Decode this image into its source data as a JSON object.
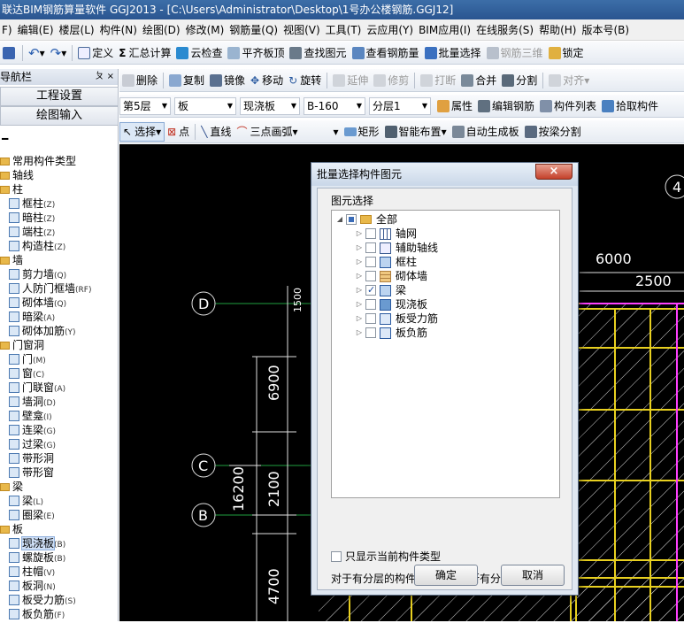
{
  "window": {
    "title": "联达BIM钢筋算量软件 GGJ2013 - [C:\\Users\\Administrator\\Desktop\\1号办公楼钢筋.GGJ12]"
  },
  "menu": [
    "F)",
    "编辑(E)",
    "楼层(L)",
    "构件(N)",
    "绘图(D)",
    "修改(M)",
    "钢筋量(Q)",
    "视图(V)",
    "工具(T)",
    "云应用(Y)",
    "BIM应用(I)",
    "在线服务(S)",
    "帮助(H)",
    "版本号(B)"
  ],
  "toolbar1": {
    "define": "定义",
    "sum": "汇总计算",
    "cloud_check": "云检查",
    "level_top": "平齐板顶",
    "find": "查找图元",
    "view_qty": "查看钢筋量",
    "batch_select": "批量选择",
    "rebar3d": "钢筋三维",
    "lock": "锁定"
  },
  "toolbar2": {
    "delete": "删除",
    "copy": "复制",
    "mirror": "镜像",
    "move": "移动",
    "rotate": "旋转",
    "extend": "延伸",
    "trim": "修剪",
    "break": "打断",
    "merge": "合并",
    "split": "分割",
    "align": "对齐"
  },
  "toolbar3": {
    "floor": "第5层",
    "category": "板",
    "type": "现浇板",
    "member": "B-160",
    "layer": "分层1",
    "props": "属性",
    "edit_rebar": "编辑钢筋",
    "member_list": "构件列表",
    "pick": "拾取构件"
  },
  "toolbar4": {
    "select": "选择",
    "point": "点",
    "line": "直线",
    "arc": "三点画弧",
    "rect": "矩形",
    "smart": "智能布置",
    "auto_slab": "自动生成板",
    "split_by_beam": "按梁分割"
  },
  "sidebar": {
    "title": "导航栏",
    "pin": "ㄆ ×",
    "btn1": "工程设置",
    "btn2": "绘图输入",
    "items": [
      {
        "text": "常用构件类型",
        "level": 0,
        "folder": true
      },
      {
        "text": "轴线",
        "level": 0,
        "folder": true
      },
      {
        "text": "柱",
        "level": 0,
        "folder": true
      },
      {
        "text": "框柱",
        "shortcut": "(Z)",
        "level": 1
      },
      {
        "text": "暗柱",
        "shortcut": "(Z)",
        "level": 1
      },
      {
        "text": "端柱",
        "shortcut": "(Z)",
        "level": 1
      },
      {
        "text": "构造柱",
        "shortcut": "(Z)",
        "level": 1
      },
      {
        "text": "墙",
        "level": 0,
        "folder": true
      },
      {
        "text": "剪力墙",
        "shortcut": "(Q)",
        "level": 1
      },
      {
        "text": "人防门框墙",
        "shortcut": "(RF)",
        "level": 1
      },
      {
        "text": "砌体墙",
        "shortcut": "(Q)",
        "level": 1
      },
      {
        "text": "暗梁",
        "shortcut": "(A)",
        "level": 1
      },
      {
        "text": "砌体加筋",
        "shortcut": "(Y)",
        "level": 1
      },
      {
        "text": "门窗洞",
        "level": 0,
        "folder": true
      },
      {
        "text": "门",
        "shortcut": "(M)",
        "level": 1
      },
      {
        "text": "窗",
        "shortcut": "(C)",
        "level": 1
      },
      {
        "text": "门联窗",
        "shortcut": "(A)",
        "level": 1
      },
      {
        "text": "墙洞",
        "shortcut": "(D)",
        "level": 1
      },
      {
        "text": "壁龛",
        "shortcut": "(I)",
        "level": 1
      },
      {
        "text": "连梁",
        "shortcut": "(G)",
        "level": 1
      },
      {
        "text": "过梁",
        "shortcut": "(G)",
        "level": 1
      },
      {
        "text": "带形洞",
        "level": 1
      },
      {
        "text": "带形窗",
        "level": 1
      },
      {
        "text": "梁",
        "level": 0,
        "folder": true
      },
      {
        "text": "梁",
        "shortcut": "(L)",
        "level": 1
      },
      {
        "text": "圈梁",
        "shortcut": "(E)",
        "level": 1
      },
      {
        "text": "板",
        "level": 0,
        "folder": true
      },
      {
        "text": "现浇板",
        "shortcut": "(B)",
        "level": 1,
        "selected": true
      },
      {
        "text": "螺旋板",
        "shortcut": "(B)",
        "level": 1
      },
      {
        "text": "柱帽",
        "shortcut": "(V)",
        "level": 1
      },
      {
        "text": "板洞",
        "shortcut": "(N)",
        "level": 1
      },
      {
        "text": "板受力筋",
        "shortcut": "(S)",
        "level": 1
      },
      {
        "text": "板负筋",
        "shortcut": "(F)",
        "level": 1
      }
    ]
  },
  "canvas": {
    "axes": [
      "D",
      "C",
      "B"
    ],
    "dims": [
      "6900",
      "2100",
      "4700",
      "16200",
      "6000",
      "2500",
      "1500"
    ],
    "corner": "4"
  },
  "dialog": {
    "title": "批量选择构件图元",
    "close": "×",
    "group_label": "图元选择",
    "root": "全部",
    "items": [
      {
        "label": "轴网",
        "checked": false,
        "icon": "grid-icon"
      },
      {
        "label": "辅助轴线",
        "checked": false,
        "icon": "aux-axis-icon"
      },
      {
        "label": "框柱",
        "checked": false,
        "icon": "column-icon"
      },
      {
        "label": "砌体墙",
        "checked": false,
        "icon": "masonry-wall-icon"
      },
      {
        "label": "梁",
        "checked": true,
        "icon": "beam-icon"
      },
      {
        "label": "现浇板",
        "checked": false,
        "icon": "slab-icon"
      },
      {
        "label": "板受力筋",
        "checked": false,
        "icon": "slab-rebar-icon"
      },
      {
        "label": "板负筋",
        "checked": false,
        "icon": "slab-neg-rebar-icon"
      }
    ],
    "only_current": "只显示当前构件类型",
    "note": "对于有分层的构件类型将选择所有分层",
    "ok": "确定",
    "cancel": "取消"
  }
}
